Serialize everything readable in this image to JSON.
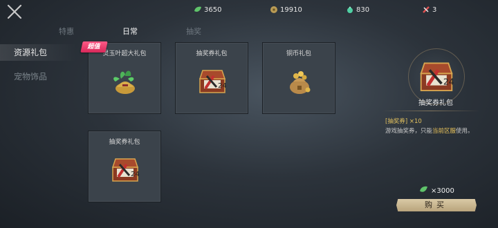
{
  "currencies": {
    "jade": "3650",
    "coin": "19910",
    "gem": "830",
    "ticket": "3"
  },
  "tabs": [
    "特惠",
    "日常",
    "抽奖"
  ],
  "sidebar": [
    "资源礼包",
    "宠物饰品"
  ],
  "cards": [
    {
      "name": "灵玉叶超大礼包"
    },
    {
      "name": "抽奖券礼包"
    },
    {
      "name": "铜币礼包"
    },
    {
      "name": "抽奖券礼包"
    }
  ],
  "badge": "超值",
  "detail": {
    "name": "抽奖券礼包",
    "item": "[抽奖券] ×10",
    "desc_prefix": "游戏抽奖券，只能",
    "desc_highlight": "当前区服",
    "desc_suffix": "使用。",
    "price": "×3000",
    "buy_label": "购买"
  },
  "colors": {
    "accent": "#e2c15e",
    "badge": "#e83a6a",
    "button": "#cbb991"
  },
  "icons": [
    "close-icon",
    "jade-leaf-icon",
    "coin-icon",
    "gem-icon",
    "ticket-icon",
    "leaf-bag-icon",
    "ticket-chest-icon",
    "coin-bag-icon"
  ]
}
